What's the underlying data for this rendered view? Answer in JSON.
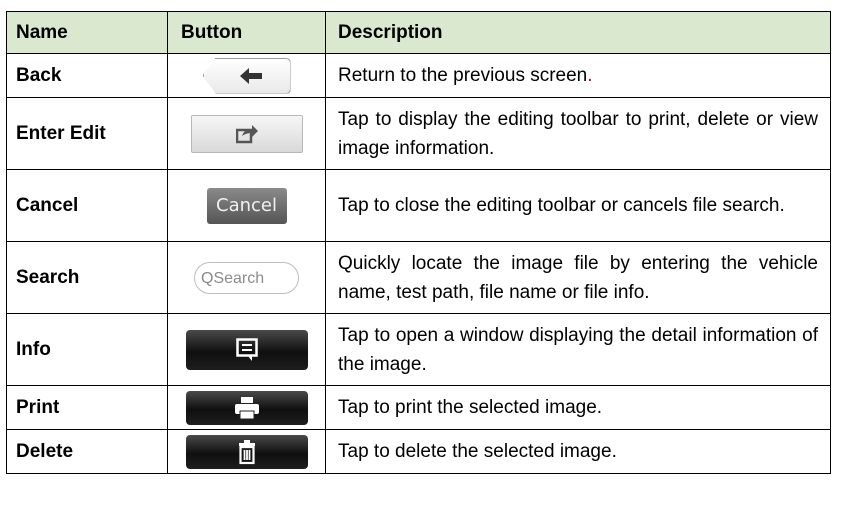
{
  "headers": {
    "name": "Name",
    "button": "Button",
    "description": "Description"
  },
  "rows": [
    {
      "name": "Back",
      "icon": "back-arrow-icon",
      "desc": "Return to the previous screen",
      "desc_tail": "."
    },
    {
      "name": "Enter Edit",
      "icon": "share-edit-icon",
      "desc": "Tap to display the editing toolbar to print, delete or view image information."
    },
    {
      "name": "Cancel",
      "button_label": "Cancel",
      "desc": "Tap to close the editing toolbar or cancels file search."
    },
    {
      "name": "Search",
      "search_icon": "Q",
      "search_placeholder": "Search",
      "desc": "Quickly locate the image file by entering the vehicle name, test path, file name or file info."
    },
    {
      "name": "Info",
      "icon": "info-message-icon",
      "desc": "Tap to open a window displaying the detail information of the image."
    },
    {
      "name": "Print",
      "icon": "printer-icon",
      "desc": "Tap to print the selected image."
    },
    {
      "name": "Delete",
      "icon": "trash-can-icon",
      "desc": "Tap to delete the selected image."
    }
  ],
  "colors": {
    "header_bg": "#d9e8cf",
    "period_accent": "#c00000"
  }
}
